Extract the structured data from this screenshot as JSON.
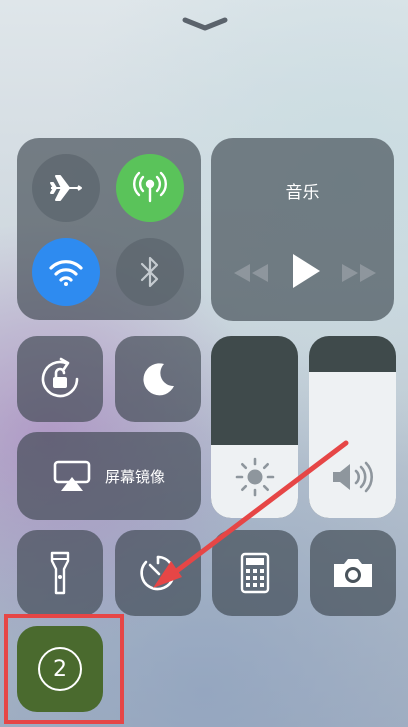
{
  "handle": {
    "icon": "chevron-down-icon"
  },
  "connectivity": {
    "airplane": {
      "icon": "airplane-icon",
      "state": "off"
    },
    "cellular": {
      "icon": "cellular-antenna-icon",
      "state": "on",
      "color": "#5ac35a"
    },
    "wifi": {
      "icon": "wifi-icon",
      "state": "on",
      "color": "#2e8bf0"
    },
    "bluetooth": {
      "icon": "bluetooth-icon",
      "state": "off"
    }
  },
  "music": {
    "title": "音乐",
    "controls": [
      "rewind-icon",
      "play-icon",
      "fast-forward-icon"
    ]
  },
  "orientation_lock": {
    "icon": "rotation-lock-icon"
  },
  "do_not_disturb": {
    "icon": "moon-icon"
  },
  "screen_mirroring": {
    "icon": "airplay-icon",
    "label": "屏幕镜像"
  },
  "brightness": {
    "icon": "sun-icon",
    "level": 0.4
  },
  "volume": {
    "icon": "speaker-volume-icon",
    "level": 0.8
  },
  "bottom_row": [
    "flashlight-icon",
    "timer-icon",
    "calculator-icon",
    "camera-icon"
  ],
  "annotation": {
    "highlight_badge": "2",
    "highlight_color": "#e64646",
    "arrow_color": "#e64646"
  },
  "colors": {
    "panel": "#374048",
    "tile_bright": "#eef1f3",
    "accent_green": "#5ac35a",
    "accent_blue": "#2e8bf0"
  }
}
